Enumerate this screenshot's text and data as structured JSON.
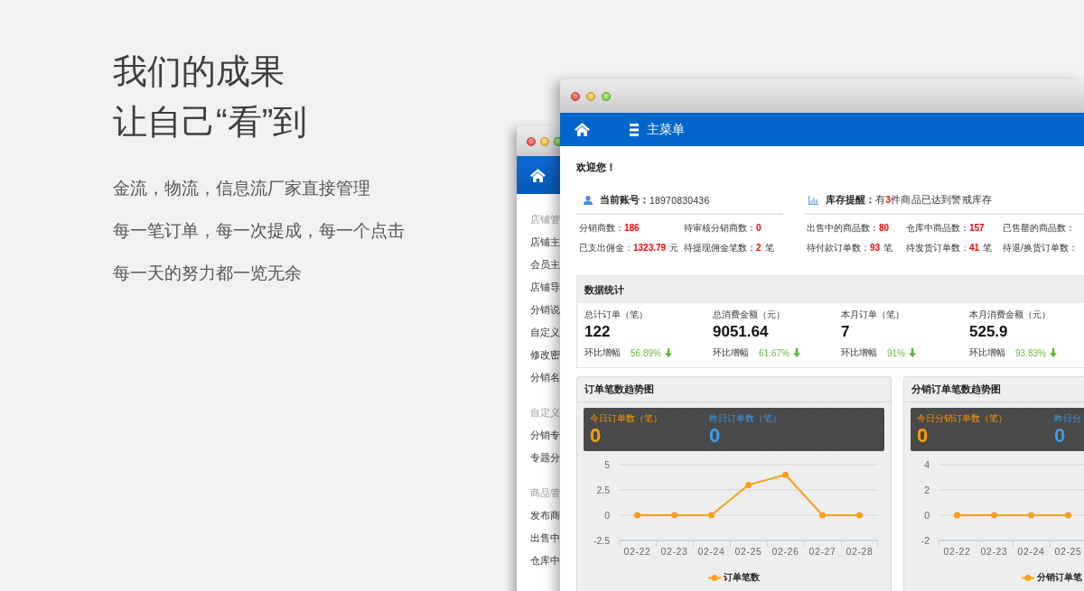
{
  "intro": {
    "title_lines": [
      "我们的成果",
      "让自己“看”到"
    ],
    "lines": [
      "金流，物流，信息流厂家直接管理",
      "每一笔订单，每一次提成，每一个点击",
      "每一天的努力都一览无余"
    ]
  },
  "back_window": {
    "sidebar": [
      {
        "heading": "店铺管",
        "items": [
          "店铺主",
          "会员主",
          "店铺导",
          "分销说",
          "自定义",
          "修改密",
          "分销名"
        ]
      },
      {
        "heading": "自定义",
        "items": [
          "分销专",
          "专题分"
        ]
      },
      {
        "heading": "商品管",
        "items": [
          "发布商",
          "出售中",
          "仓库中"
        ]
      }
    ]
  },
  "main_window": {
    "menu_label": "主菜单",
    "welcome": "欢迎您！",
    "account": {
      "label": "当前账号：",
      "value": "18970830436"
    },
    "stock_alert": {
      "label": "库存提醒：",
      "text": "有**3**件商品已达到警戒库存"
    },
    "account_stats": [
      {
        "label": "分销商数：",
        "value": "186"
      },
      {
        "label": "待审核分销商数：",
        "value": "0"
      },
      {
        "label": "已支出佣金：",
        "value": "1323.79",
        "unit": "元"
      },
      {
        "label": "待提现佣金笔数：",
        "value": "2",
        "unit": "笔"
      }
    ],
    "store_stats": [
      {
        "label": "出售中的商品数：",
        "value": "80"
      },
      {
        "label": "仓库中商品数：",
        "value": "157"
      },
      {
        "label": "已售罄的商品数："
      },
      {
        "label": "待付款订单数：",
        "value": "93",
        "unit": "笔"
      },
      {
        "label": "待发货订单数：",
        "value": "41",
        "unit": "笔"
      },
      {
        "label": "待退/换货订单数："
      }
    ],
    "stats_panel": {
      "title": "数据统计",
      "items": [
        {
          "label": "总计订单（笔）",
          "value": "122",
          "change_label": "环比增幅",
          "change": "56.89%",
          "falling": true
        },
        {
          "label": "总消费金额（元）",
          "value": "9051.64",
          "change_label": "环比增幅",
          "change": "61.67%",
          "falling": true
        },
        {
          "label": "本月订单（笔）",
          "value": "7",
          "change_label": "环比增幅",
          "change": "91%",
          "falling": true
        },
        {
          "label": "本月消费金额（元）",
          "value": "525.9",
          "change_label": "环比增幅",
          "change": "93.83%",
          "falling": true
        }
      ]
    },
    "chart_panels": [
      {
        "title": "订单笔数趋势图",
        "today": {
          "label": "今日订单数（笔）",
          "value": "0"
        },
        "yesterday": {
          "label": "昨日订单数（笔）",
          "value": "0"
        },
        "chart_data": {
          "type": "line",
          "categories": [
            "02-22",
            "02-23",
            "02-24",
            "02-25",
            "02-26",
            "02-27",
            "02-28"
          ],
          "series": [
            {
              "name": "订单笔数",
              "color": "#f7a11a",
              "marker": "circle",
              "values": [
                0,
                0,
                0,
                3,
                4,
                0,
                0
              ]
            }
          ],
          "ylim": [
            -2.5,
            5
          ],
          "yticks": [
            5,
            2.5,
            0,
            -2.5
          ]
        }
      },
      {
        "title": "分销订单笔数趋势图",
        "today": {
          "label": "今日分销订单数（笔）",
          "value": "0"
        },
        "yesterday": {
          "label": "昨日分",
          "value": "0"
        },
        "chart_data": {
          "type": "line",
          "categories": [
            "02-22",
            "02-23",
            "02-24",
            "02-25"
          ],
          "series": [
            {
              "name": "分销订单笔",
              "color": "#f7a11a",
              "marker": "circle",
              "values": [
                0,
                0,
                0,
                0
              ]
            }
          ],
          "ylim": [
            -2,
            4
          ],
          "yticks": [
            4,
            2,
            0,
            -2
          ]
        }
      }
    ]
  }
}
